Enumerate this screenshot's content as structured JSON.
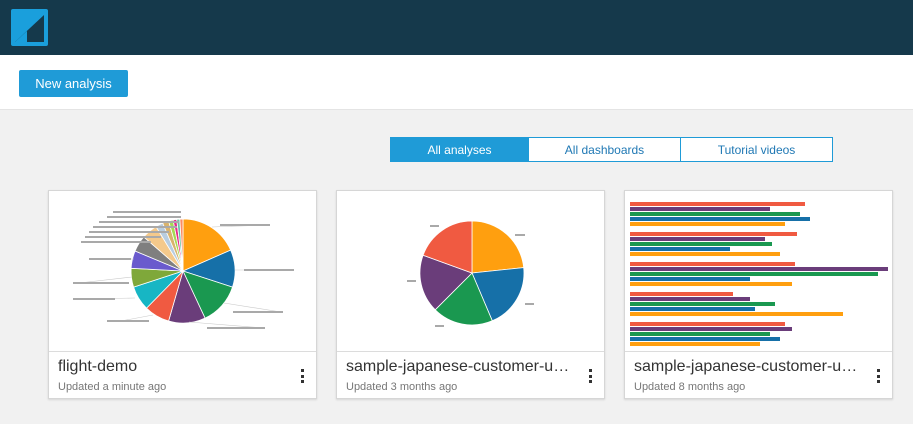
{
  "toolbar": {
    "new_analysis_label": "New analysis"
  },
  "tabs": [
    {
      "label": "All analyses",
      "active": true
    },
    {
      "label": "All dashboards",
      "active": false
    },
    {
      "label": "Tutorial videos",
      "active": false
    }
  ],
  "cards": [
    {
      "title": "flight-demo",
      "updated": "Updated a minute ago",
      "thumbnail": "pie-chart-with-many-slices"
    },
    {
      "title": "sample-japanese-customer-utf...",
      "updated": "Updated 3 months ago",
      "thumbnail": "pie-chart"
    },
    {
      "title": "sample-japanese-customer-utf...",
      "updated": "Updated 8 months ago",
      "thumbnail": "horizontal-bar-chart"
    }
  ],
  "colors": {
    "header_bg": "#15394b",
    "accent": "#1f9bd7",
    "chart_palette": [
      "#ff9f0f",
      "#1670a8",
      "#1a9850",
      "#6a3d7a",
      "#f05a41",
      "#17b6c4",
      "#7fa83a",
      "#6a5acd",
      "#7f7f7f",
      "#f4c98b"
    ]
  }
}
